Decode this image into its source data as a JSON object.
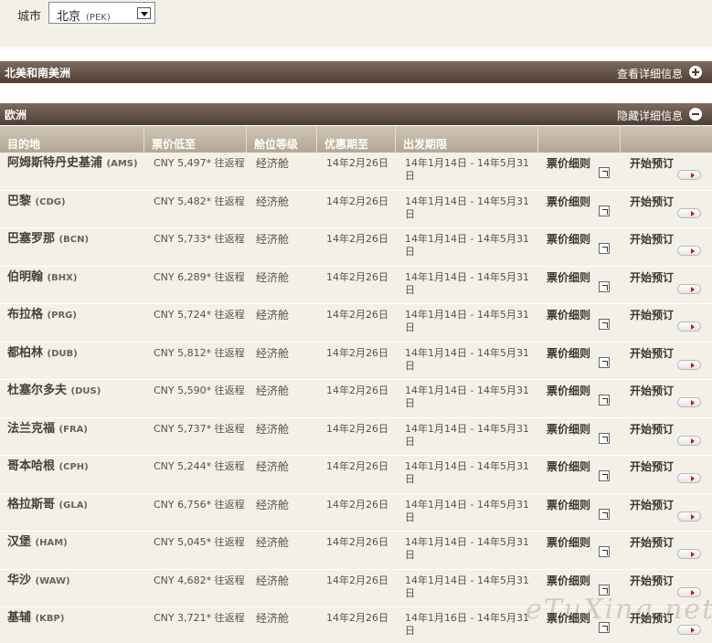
{
  "city": {
    "label": "城市",
    "value": "北京",
    "code": "(PEK)"
  },
  "regions": [
    {
      "name": "北美和南美洲",
      "toggle": "查看详细信息"
    },
    {
      "name": "欧洲",
      "toggle": "隐藏详细信息"
    }
  ],
  "columns": [
    "目的地",
    "票价低至",
    "舱位等级",
    "优惠期至",
    "出发期限"
  ],
  "rows": [
    {
      "dest": "阿姆斯特丹史基浦",
      "code": "(AMS)",
      "price": "CNY 5,497* 往返程",
      "cabin": "经济舱",
      "expire": "14年2月26日",
      "travel": "14年1月14日 - 14年5月31日",
      "detail": "票价细则",
      "book": "开始预订"
    },
    {
      "dest": "巴黎",
      "code": "(CDG)",
      "price": "CNY 5,482* 往返程",
      "cabin": "经济舱",
      "expire": "14年2月26日",
      "travel": "14年1月14日 - 14年5月31日",
      "detail": "票价细则",
      "book": "开始预订"
    },
    {
      "dest": "巴塞罗那",
      "code": "(BCN)",
      "price": "CNY 5,733* 往返程",
      "cabin": "经济舱",
      "expire": "14年2月26日",
      "travel": "14年1月14日 - 14年5月31日",
      "detail": "票价细则",
      "book": "开始预订"
    },
    {
      "dest": "伯明翰",
      "code": "(BHX)",
      "price": "CNY 6,289* 往返程",
      "cabin": "经济舱",
      "expire": "14年2月26日",
      "travel": "14年1月14日 - 14年5月31日",
      "detail": "票价细则",
      "book": "开始预订"
    },
    {
      "dest": "布拉格",
      "code": "(PRG)",
      "price": "CNY 5,724* 往返程",
      "cabin": "经济舱",
      "expire": "14年2月26日",
      "travel": "14年1月14日 - 14年5月31日",
      "detail": "票价细则",
      "book": "开始预订"
    },
    {
      "dest": "都柏林",
      "code": "(DUB)",
      "price": "CNY 5,812* 往返程",
      "cabin": "经济舱",
      "expire": "14年2月26日",
      "travel": "14年1月14日 - 14年5月31日",
      "detail": "票价细则",
      "book": "开始预订"
    },
    {
      "dest": "杜塞尔多夫",
      "code": "(DUS)",
      "price": "CNY 5,590* 往返程",
      "cabin": "经济舱",
      "expire": "14年2月26日",
      "travel": "14年1月14日 - 14年5月31日",
      "detail": "票价细则",
      "book": "开始预订"
    },
    {
      "dest": "法兰克福",
      "code": "(FRA)",
      "price": "CNY 5,737* 往返程",
      "cabin": "经济舱",
      "expire": "14年2月26日",
      "travel": "14年1月14日 - 14年5月31日",
      "detail": "票价细则",
      "book": "开始预订"
    },
    {
      "dest": "哥本哈根",
      "code": "(CPH)",
      "price": "CNY 5,244* 往返程",
      "cabin": "经济舱",
      "expire": "14年2月26日",
      "travel": "14年1月14日 - 14年5月31日",
      "detail": "票价细则",
      "book": "开始预订"
    },
    {
      "dest": "格拉斯哥",
      "code": "(GLA)",
      "price": "CNY 6,756* 往返程",
      "cabin": "经济舱",
      "expire": "14年2月26日",
      "travel": "14年1月14日 - 14年5月31日",
      "detail": "票价细则",
      "book": "开始预订"
    },
    {
      "dest": "汉堡",
      "code": "(HAM)",
      "price": "CNY 5,045* 往返程",
      "cabin": "经济舱",
      "expire": "14年2月26日",
      "travel": "14年1月14日 - 14年5月31日",
      "detail": "票价细则",
      "book": "开始预订"
    },
    {
      "dest": "华沙",
      "code": "(WAW)",
      "price": "CNY 4,682* 往返程",
      "cabin": "经济舱",
      "expire": "14年2月26日",
      "travel": "14年1月14日 - 14年5月31日",
      "detail": "票价细则",
      "book": "开始预订"
    },
    {
      "dest": "基辅",
      "code": "(KBP)",
      "price": "CNY 3,721* 往返程",
      "cabin": "经济舱",
      "expire": "14年2月26日",
      "travel": "14年1月16日 - 14年5月31日",
      "detail": "票价细则",
      "book": "开始预订"
    }
  ],
  "watermark": "eTuXing.net"
}
